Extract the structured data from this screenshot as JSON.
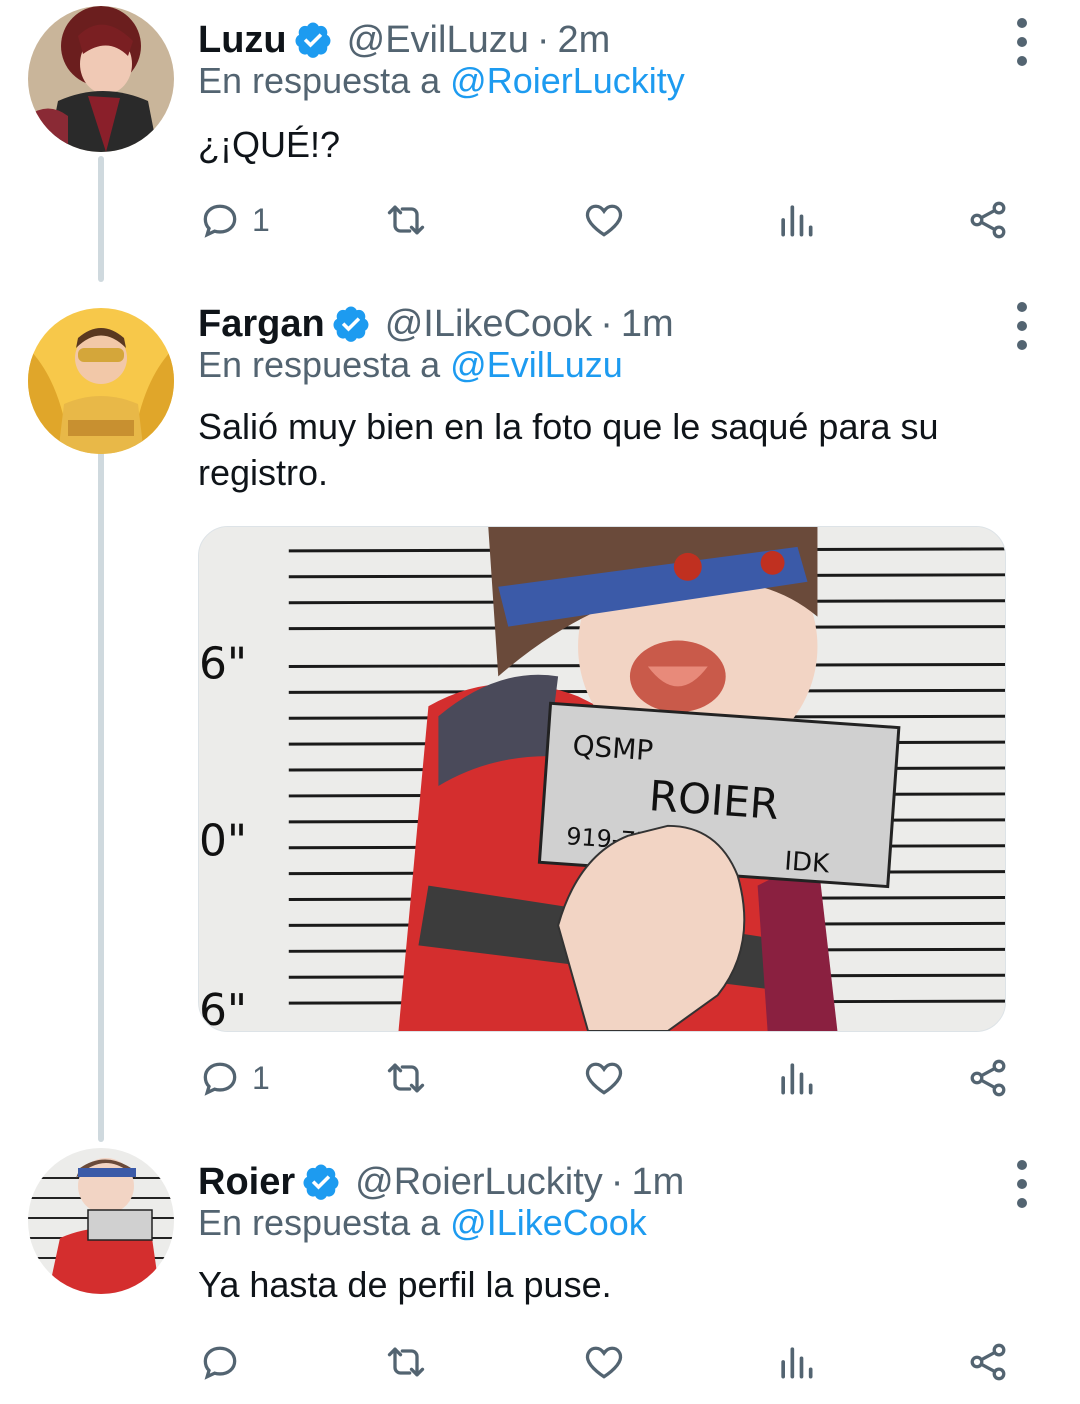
{
  "tweets": [
    {
      "name": "Luzu",
      "handle": "@EvilLuzu",
      "separator": "·",
      "time": "2m",
      "reply_prefix": "En respuesta a ",
      "reply_to": "@RoierLuckity",
      "text": "¿¡QUÉ!?",
      "reply_count": "1"
    },
    {
      "name": "Fargan",
      "handle": "@ILikeCook",
      "separator": "·",
      "time": "1m",
      "reply_prefix": "En respuesta a ",
      "reply_to": "@EvilLuzu",
      "text": "Salió muy bien en la foto que le saqué para su registro.",
      "reply_count": "1",
      "media": {
        "card_top": "QSMP",
        "card_name": "ROIER",
        "card_number": "919-77",
        "card_corner": "IDK",
        "height_marks": [
          "6\"",
          "0\"",
          "6\""
        ]
      }
    },
    {
      "name": "Roier",
      "handle": "@RoierLuckity",
      "separator": "·",
      "time": "1m",
      "reply_prefix": "En respuesta a ",
      "reply_to": "@ILikeCook",
      "text": "Ya hasta de perfil la puse.",
      "reply_count": ""
    }
  ],
  "colors": {
    "accent": "#1d9bf0",
    "secondary_text": "#536471",
    "primary_text": "#0f1419",
    "thread_line": "#cfd9de"
  },
  "icons": [
    "verified-badge-icon",
    "more-options-icon",
    "reply-icon",
    "retweet-icon",
    "like-icon",
    "views-icon",
    "share-icon"
  ]
}
